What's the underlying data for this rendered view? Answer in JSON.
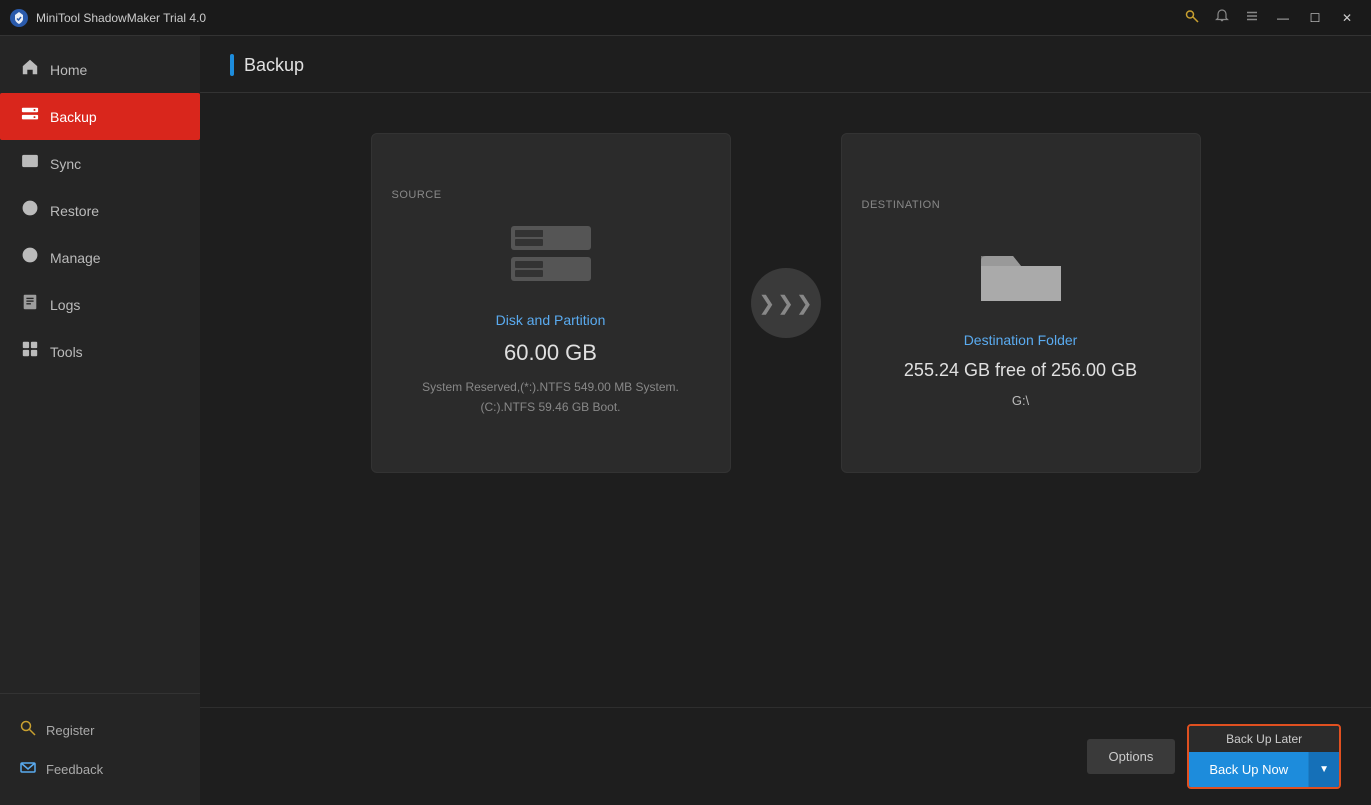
{
  "titleBar": {
    "logo": "🛡",
    "title": "MiniTool ShadowMaker Trial 4.0",
    "controls": {
      "key_icon": "key",
      "bell_icon": "bell",
      "menu_icon": "menu",
      "minimize": "—",
      "maximize": "☐",
      "close": "✕"
    }
  },
  "sidebar": {
    "nav": [
      {
        "id": "home",
        "label": "Home",
        "icon": "home"
      },
      {
        "id": "backup",
        "label": "Backup",
        "icon": "backup",
        "active": true
      },
      {
        "id": "sync",
        "label": "Sync",
        "icon": "sync"
      },
      {
        "id": "restore",
        "label": "Restore",
        "icon": "restore"
      },
      {
        "id": "manage",
        "label": "Manage",
        "icon": "manage"
      },
      {
        "id": "logs",
        "label": "Logs",
        "icon": "logs"
      },
      {
        "id": "tools",
        "label": "Tools",
        "icon": "tools"
      }
    ],
    "bottom": [
      {
        "id": "register",
        "label": "Register",
        "icon": "key"
      },
      {
        "id": "feedback",
        "label": "Feedback",
        "icon": "mail"
      }
    ]
  },
  "pageHeader": {
    "title": "Backup"
  },
  "sourceCard": {
    "label": "SOURCE",
    "iconType": "disk",
    "title": "Disk and Partition",
    "size": "60.00 GB",
    "description": "System Reserved,(*:).NTFS 549.00 MB System.\n(C:).NTFS 59.46 GB Boot."
  },
  "destinationCard": {
    "label": "DESTINATION",
    "iconType": "folder",
    "title": "Destination Folder",
    "freeSpace": "255.24 GB free of 256.00 GB",
    "path": "G:\\"
  },
  "bottomBar": {
    "optionsLabel": "Options",
    "backUpLaterLabel": "Back Up Later",
    "backUpNowLabel": "Back Up Now"
  }
}
